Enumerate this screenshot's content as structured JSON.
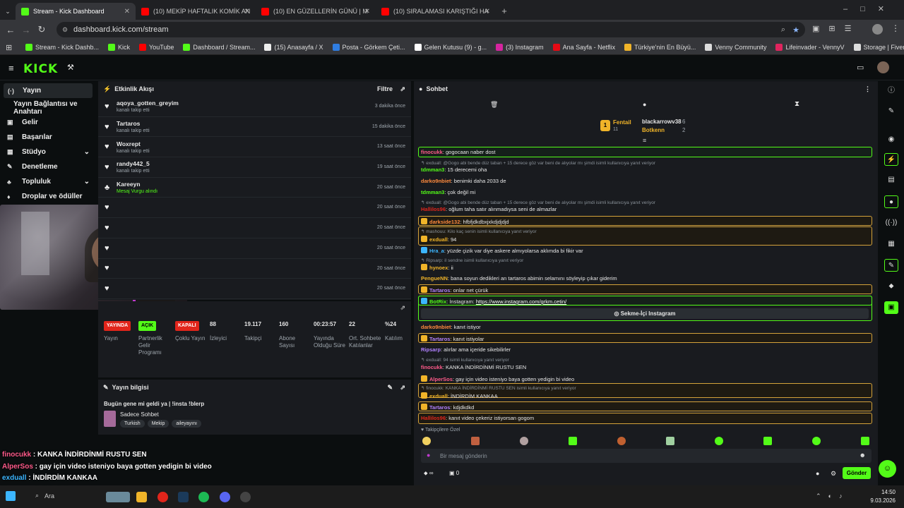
{
  "browser": {
    "tabs": [
      {
        "title": "Stream - Kick Dashboard",
        "fav": "#53fc18"
      },
      {
        "title": "(10) MEKİP HAFTALIK KOMİK AN",
        "fav": "#ff0000"
      },
      {
        "title": "(10) EN GÜZELLERİN GÜNÜ | M",
        "fav": "#ff0000"
      },
      {
        "title": "(10) SIRALAMASI KARIŞTIĞI HA",
        "fav": "#ff0000"
      }
    ],
    "new_tab": "+",
    "url": "dashboard.kick.com/stream",
    "bookmarks": [
      {
        "label": "Stream - Kick Dashb...",
        "color": "#53fc18"
      },
      {
        "label": "Kick",
        "color": "#53fc18"
      },
      {
        "label": "YouTube",
        "color": "#ff0000"
      },
      {
        "label": "Dashboard / Stream...",
        "color": "#53fc18"
      },
      {
        "label": "(15) Anasayfa / X",
        "color": "#eeeeee"
      },
      {
        "label": "Posta - Görkem Çeti...",
        "color": "#2f7de1"
      },
      {
        "label": "Gelen Kutusu (9) - g...",
        "color": "#ffffff"
      },
      {
        "label": "(3) Instagram",
        "color": "#d6249f"
      },
      {
        "label": "Ana Sayfa - Netflix",
        "color": "#e50914"
      },
      {
        "label": "Türkiye'nin En Büyü...",
        "color": "#f0b429"
      },
      {
        "label": "Venny Community",
        "color": "#dddddd"
      },
      {
        "label": "Lifeinvader - VennyV",
        "color": "#e0245e"
      },
      {
        "label": "Storage | Fivemanage",
        "color": "#dddddd"
      }
    ]
  },
  "kick": {
    "logo": "KICK",
    "sidebar": [
      {
        "label": "Yayın",
        "icon": "(·)",
        "active": true
      },
      {
        "label": "Yayın Bağlantısı ve Anahtarı",
        "icon": ""
      },
      {
        "label": "Gelir",
        "icon": "▣"
      },
      {
        "label": "Başarılar",
        "icon": "▤"
      },
      {
        "label": "Stüdyo",
        "icon": "▦",
        "chev": "⌄"
      },
      {
        "label": "Denetleme",
        "icon": "✎"
      },
      {
        "label": "Topluluk",
        "icon": "♣",
        "chev": "⌄"
      },
      {
        "label": "Droplar ve ödüller",
        "icon": "♦"
      }
    ],
    "activity": {
      "title": "Etkinlik Akışı",
      "filter": "Filtre",
      "rows": [
        {
          "name": "aqoya_gotten_greyim",
          "sub": "kanalı takip etti",
          "time": "3 dakika önce"
        },
        {
          "name": "Tartaros",
          "sub": "kanalı takip etti",
          "time": "15 dakika önce"
        },
        {
          "name": "Woxrept",
          "sub": "kanalı takip etti",
          "time": "13 saat önce"
        },
        {
          "name": "randy442_5",
          "sub": "kanalı takip etti",
          "time": "19 saat önce"
        },
        {
          "name": "Kareeyn",
          "sub": "Mesaj Vurgu alındı",
          "time": "20 saat önce"
        },
        {
          "name": "",
          "sub": "",
          "time": "20 saat önce"
        },
        {
          "name": "",
          "sub": "",
          "time": "20 saat önce"
        },
        {
          "name": "",
          "sub": "",
          "time": "20 saat önce"
        },
        {
          "name": "",
          "sub": "",
          "time": "20 saat önce"
        },
        {
          "name": "",
          "sub": "",
          "time": "20 saat önce"
        }
      ]
    },
    "stats": [
      {
        "value": "YAYINDA",
        "label": "Yayın",
        "badge": "#e1251b"
      },
      {
        "value": "AÇIK",
        "label": "Partnerlik Gelir Programı",
        "badge": "#53fc18"
      },
      {
        "value": "KAPALI",
        "label": "Çoklu Yayın",
        "badge": "#e1251b"
      },
      {
        "value": "88",
        "label": "İzleyici"
      },
      {
        "value": "19.117",
        "label": "Takipçi"
      },
      {
        "value": "160",
        "label": "Abone Sayısı"
      },
      {
        "value": "00:23:57",
        "label": "Yayında Olduğu Süre"
      },
      {
        "value": "22",
        "label": "Ort. Sohbete Katılanlar"
      },
      {
        "value": "%24",
        "label": "Katılım"
      }
    ],
    "stream_info": {
      "title": "Yayın bilgisi",
      "stream_title": "Bugün gene mi geldi ya | !insta !blerp",
      "category": "Sadece Sohbet",
      "tags": [
        "Turkish",
        "Mekip",
        "aileyayını"
      ]
    },
    "chat": {
      "title": "Sohbet",
      "pinned": {
        "first": "Fentail",
        "first_count": "11",
        "second": "blackarrowv38",
        "second_count": "6",
        "third": "Botkenn",
        "third_count": "2"
      },
      "messages": [
        {
          "user": "finocukk",
          "text": "gogocaan naber dost",
          "color": "#ff5a8a"
        },
        {
          "reply": "exduall: @Gogo abi bende düz taban + 15 derece göz var beni de alıyolar mı şimdi isimli kullanıcıya yanıt veriyor"
        },
        {
          "user": "tdmman3",
          "text": "15 derecemi oha",
          "color": "#53fc18"
        },
        {
          "user": "darko9nbiet",
          "text": "benimki daha 2033 de",
          "color": "#ff8a3d"
        },
        {
          "user": "tdmman3",
          "text": "çok değil mi",
          "color": "#53fc18"
        },
        {
          "reply": "exduall: @Gogo abi bende düz taban + 15 derece göz var beni de alıyolar mı şimdi isimli kullanıcıya yanıt veriyor"
        },
        {
          "user": "Hallilos96",
          "text": "oğlum taha satır alınmadıysa seni de almazlar",
          "color": "#e1251b"
        },
        {
          "user": "darkside132",
          "text": "hfbfjdkdbxjxkdjdjdjd",
          "color": "#ff8a3d"
        },
        {
          "reply": "mashouu: Kilo kaç senin isimli kullanıcıya yanıt veriyor"
        },
        {
          "user": "exduall",
          "text": "94",
          "color": "#f0b429"
        },
        {
          "user": "Hra_a",
          "text": "yüzde çizik var diye askere almıyolarsa aklımda bi fikir var",
          "color": "#3cb6ff"
        },
        {
          "reply": "Ripsarp: il sendne isimli kullanıcıya yanıt veriyor"
        },
        {
          "user": "hynoex",
          "text": "ii",
          "color": "#f0b429"
        },
        {
          "user": "PengueNN",
          "text": "bana soyun dedikleri an tartaros abimin selamını söyleyip çıkar giderim",
          "color": "#f0b429"
        },
        {
          "user": "Tartaros",
          "text": "onlar net çürük",
          "color": "#b080ff"
        },
        {
          "user": "BotRix",
          "text": "İnstagram: ",
          "link": "https://www.instagram.com/grkm.cetin/",
          "color": "#53fc18"
        },
        {
          "button": "Sekme-İçi Instagram"
        },
        {
          "user": "darko9nbiet",
          "text": "kanıt istiyor",
          "color": "#ff8a3d"
        },
        {
          "user": "Tartaros",
          "text": "kanıt istiyolar",
          "color": "#b080ff"
        },
        {
          "user": "Ripsarp",
          "text": "alırlar ama içeride sikebilirler",
          "color": "#b080ff"
        },
        {
          "reply": "exduall: 94 isimli kullanıcıya yanıt veriyor"
        },
        {
          "user": "finocukk",
          "text": "KANKA İNDİRDİNMİ RUSTU SEN",
          "color": "#ff5a8a"
        },
        {
          "user": "AlperSos",
          "text": "gay için video isteniyo baya gotten yedigin bi video",
          "color": "#ff5a8a"
        },
        {
          "reply": "finocukk: KANKA İNDİRDİNMİ RUSTU SEN isimli kullanıcıya yanıt veriyor"
        },
        {
          "user": "exduall",
          "text": "İNDİRDİM KANKAA",
          "color": "#f0b429"
        },
        {
          "user": "Tartaros",
          "text": "kdjdkdkd",
          "color": "#b080ff"
        },
        {
          "user": "Hallilos96",
          "text": "kanıt video çekeriz istiyorsan gogom",
          "color": "#e1251b"
        }
      ],
      "emote_label": "Takipçilere Özel",
      "input_placeholder": "Bir mesaj gönderin",
      "infinity": "∞",
      "zero": "0",
      "send": "Gönder"
    }
  },
  "overlay": [
    {
      "user": "finocukk",
      "text": " : KANKA İNDİRDİNMİ RUSTU SEN",
      "color": "#ff5a8a"
    },
    {
      "user": "AlperSos",
      "text": " : gay için video isteniyo baya gotten yedigin bi video",
      "color": "#ff5a8a"
    },
    {
      "user": "exduall",
      "text": " : İNDİRDİM KANKAA",
      "color": "#3cb6ff"
    },
    {
      "user": "Tartaros",
      "text": " : kdjdkdkd",
      "color": "#b080ff"
    },
    {
      "user": "Hallilos96",
      "text": " : kanıt video çekeriz istiyorsan gogom",
      "color": "#e1251b"
    }
  ],
  "taskbar": {
    "search": "Ara",
    "time": "14:50",
    "date": "9.03.2026"
  }
}
